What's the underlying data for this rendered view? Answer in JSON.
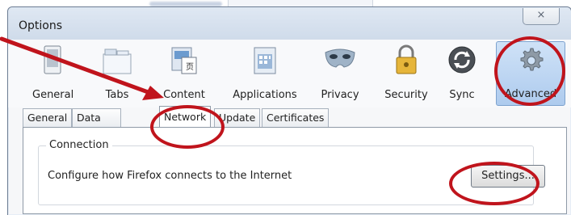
{
  "window": {
    "title": "Options",
    "close_glyph": "⨯"
  },
  "toolbar": {
    "items": [
      {
        "label": "General",
        "icon": "general-icon"
      },
      {
        "label": "Tabs",
        "icon": "tabs-icon"
      },
      {
        "label": "Content",
        "icon": "content-icon"
      },
      {
        "label": "Applications",
        "icon": "applications-icon"
      },
      {
        "label": "Privacy",
        "icon": "privacy-icon"
      },
      {
        "label": "Security",
        "icon": "security-icon"
      },
      {
        "label": "Sync",
        "icon": "sync-icon"
      },
      {
        "label": "Advanced",
        "icon": "gear-icon",
        "selected": true
      }
    ]
  },
  "subtabs": [
    {
      "label": "General"
    },
    {
      "label": "Data Choices"
    },
    {
      "label": "Network",
      "active": true
    },
    {
      "label": "Update"
    },
    {
      "label": "Certificates"
    }
  ],
  "connection": {
    "title": "Connection",
    "description": "Configure how Firefox connects to the Internet",
    "settings_label": "Settings..."
  },
  "annotation_color": "#c0141c"
}
